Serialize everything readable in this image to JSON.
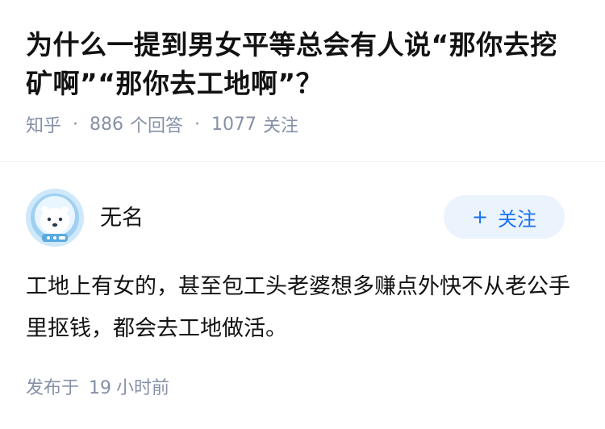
{
  "question": {
    "title": "为什么一提到男女平等总会有人说“那你去挖矿啊”“那你去工地啊”？",
    "source": "知乎",
    "answers_count": "886",
    "answers_label": "个回答",
    "followers_count": "1077",
    "followers_label": "关注",
    "separator": "·"
  },
  "answer": {
    "author_name": "无名",
    "avatar_icon": "polar-bear-astronaut-avatar",
    "follow_button_plus": "+",
    "follow_button_label": "关注",
    "content": "工地上有女的，甚至包工头老婆想多赚点外快不从老公手里抠钱，都会去工地做活。",
    "published_prefix": "发布于",
    "published_num": "19",
    "published_suffix": "小时前"
  },
  "colors": {
    "title": "#121212",
    "meta": "#8590a6",
    "accent": "#1772f6",
    "follow_bg": "#ebf3fd",
    "avatar_bg": "#c8e4f8"
  }
}
